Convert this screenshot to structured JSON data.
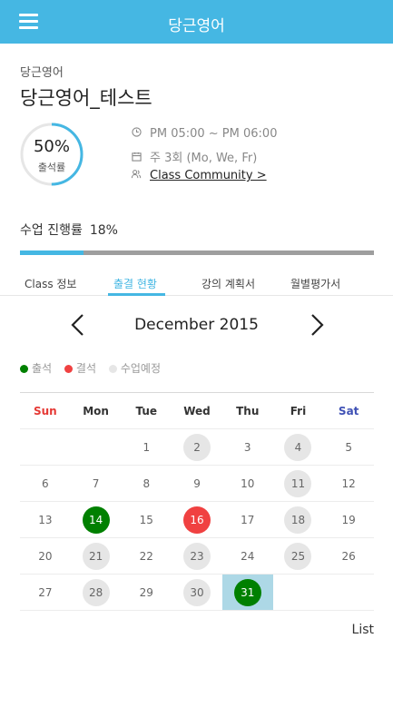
{
  "header": {
    "title": "당근영어",
    "menu_icon": "hamburger-menu-icon"
  },
  "course": {
    "category": "당근영어",
    "title": "당근영어_테스트",
    "attendance_rate": 0.5,
    "attendance_pct_text": "50%",
    "attendance_label": "출석률",
    "time": "PM 05:00 ~ PM 06:00",
    "schedule": "주 3회 (Mo, We, Fr)",
    "community_link": "Class Community >",
    "icons": {
      "time": "clock-icon",
      "schedule": "calendar-icon",
      "community": "people-icon"
    }
  },
  "progress": {
    "label": "수업 진행률",
    "value_text": "18%",
    "value": 0.18
  },
  "tabs": [
    {
      "label": "Class 정보",
      "active": false
    },
    {
      "label": "출결 현황",
      "active": true
    },
    {
      "label": "강의 계획서",
      "active": false
    },
    {
      "label": "월별평가서",
      "active": false
    }
  ],
  "calendar": {
    "month_label": "December 2015",
    "prev_icon": "chevron-left-icon",
    "next_icon": "chevron-right-icon",
    "legend": [
      {
        "label": "출석",
        "color": "#008000"
      },
      {
        "label": "결석",
        "color": "#f04141"
      },
      {
        "label": "수업예정",
        "color": "#e6e6e6"
      }
    ],
    "weekdays": [
      "Sun",
      "Mon",
      "Tue",
      "Wed",
      "Thu",
      "Fri",
      "Sat"
    ],
    "weeks": [
      [
        null,
        null,
        {
          "d": "1"
        },
        {
          "d": "2",
          "s": "sched"
        },
        {
          "d": "3"
        },
        {
          "d": "4",
          "s": "sched"
        },
        {
          "d": "5"
        }
      ],
      [
        {
          "d": "6"
        },
        {
          "d": "7"
        },
        {
          "d": "8"
        },
        {
          "d": "9"
        },
        {
          "d": "10"
        },
        {
          "d": "11",
          "s": "sched"
        },
        {
          "d": "12"
        }
      ],
      [
        {
          "d": "13"
        },
        {
          "d": "14",
          "s": "present"
        },
        {
          "d": "15"
        },
        {
          "d": "16",
          "s": "absent"
        },
        {
          "d": "17"
        },
        {
          "d": "18",
          "s": "sched"
        },
        {
          "d": "19"
        }
      ],
      [
        {
          "d": "20"
        },
        {
          "d": "21",
          "s": "sched"
        },
        {
          "d": "22"
        },
        {
          "d": "23",
          "s": "sched"
        },
        {
          "d": "24"
        },
        {
          "d": "25",
          "s": "sched"
        },
        {
          "d": "26"
        }
      ],
      [
        {
          "d": "27"
        },
        {
          "d": "28",
          "s": "sched"
        },
        {
          "d": "29"
        },
        {
          "d": "30",
          "s": "sched"
        },
        {
          "d": "31",
          "s": "present",
          "today": true
        },
        null,
        null
      ]
    ]
  },
  "list_button": "List",
  "colors": {
    "accent": "#45b7e3",
    "present": "#008000",
    "absent": "#f04141",
    "scheduled": "#e6e6e6",
    "today_bg": "#add8e6"
  }
}
